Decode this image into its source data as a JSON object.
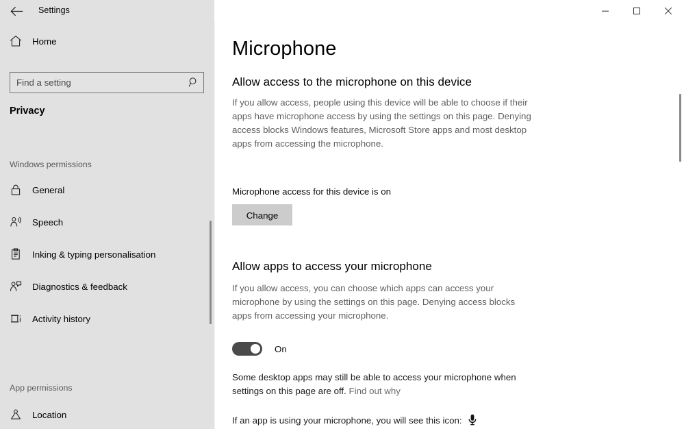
{
  "window": {
    "app_title": "Settings",
    "back_icon": "back-arrow-icon",
    "minimize_label": "Minimise",
    "maximize_label": "Maximise",
    "close_label": "Close"
  },
  "sidebar": {
    "home": {
      "label": "Home",
      "icon": "home-icon"
    },
    "search": {
      "placeholder": "Find a setting",
      "value": "",
      "icon": "search-icon"
    },
    "category": "Privacy",
    "groups": [
      {
        "heading": "Windows permissions",
        "items": [
          {
            "label": "General",
            "icon": "lock-icon"
          },
          {
            "label": "Speech",
            "icon": "speech-person-icon"
          },
          {
            "label": "Inking & typing personalisation",
            "icon": "clipboard-pen-icon"
          },
          {
            "label": "Diagnostics & feedback",
            "icon": "person-feedback-icon"
          },
          {
            "label": "Activity history",
            "icon": "activity-history-icon"
          }
        ]
      },
      {
        "heading": "App permissions",
        "items": [
          {
            "label": "Location",
            "icon": "location-pin-icon"
          }
        ]
      }
    ]
  },
  "main": {
    "page_title": "Microphone",
    "sections": [
      {
        "heading": "Allow access to the microphone on this device",
        "description": "If you allow access, people using this device will be able to choose if their apps have microphone access by using the settings on this page. Denying access blocks Windows features, Microsoft Store apps and most desktop apps from accessing the microphone.",
        "status": "Microphone access for this device is on",
        "button": "Change"
      },
      {
        "heading": "Allow apps to access your microphone",
        "description": "If you allow access, you can choose which apps can access your microphone by using the settings on this page. Denying access blocks apps from accessing your microphone.",
        "toggle_state": "On",
        "note_text": "Some desktop apps may still be able to access your microphone when settings on this page are off.",
        "note_link": "Find out why",
        "icon_note": "If an app is using your microphone, you will see this icon:",
        "icon_name": "microphone-icon"
      }
    ]
  },
  "colors": {
    "sidebar_bg": "#e1e1e1",
    "content_bg": "#ffffff",
    "button_bg": "#cccccc",
    "toggle_on": "#4a4a4a",
    "body_text": "#5f5f5f",
    "scrollbar": "#8a8a8a"
  }
}
